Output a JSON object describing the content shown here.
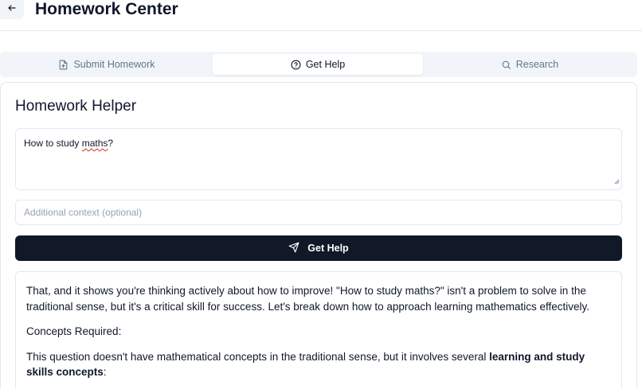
{
  "header": {
    "title": "Homework Center",
    "back_icon": "arrow-left-icon"
  },
  "tabs": [
    {
      "label": "Submit Homework",
      "icon": "file-upload-icon",
      "active": false
    },
    {
      "label": "Get Help",
      "icon": "help-circle-icon",
      "active": true
    },
    {
      "label": "Research",
      "icon": "search-icon",
      "active": false
    }
  ],
  "helper": {
    "title": "Homework Helper",
    "question_prefix": "How to study ",
    "question_misspelled": "maths",
    "question_suffix": "?",
    "context_placeholder": "Additional context (optional)",
    "button_label": "Get Help",
    "button_icon": "send-icon"
  },
  "response": {
    "paragraph1": "That, and it shows you're thinking actively about how to improve! \"How to study maths?\" isn't a problem to solve in the traditional sense, but it's a critical skill for success. Let's break down how to approach learning mathematics effectively.",
    "paragraph2": "Concepts Required:",
    "paragraph3_text": "This question doesn't have mathematical concepts in the traditional sense, but it involves several ",
    "paragraph3_bold": "learning and study skills concepts",
    "paragraph3_end": ":"
  },
  "colors": {
    "primary_button": "#111827",
    "tab_bar": "#f1f5f9",
    "border": "#e2e8f0",
    "muted_text": "#64748b",
    "placeholder": "#94a3b8"
  }
}
